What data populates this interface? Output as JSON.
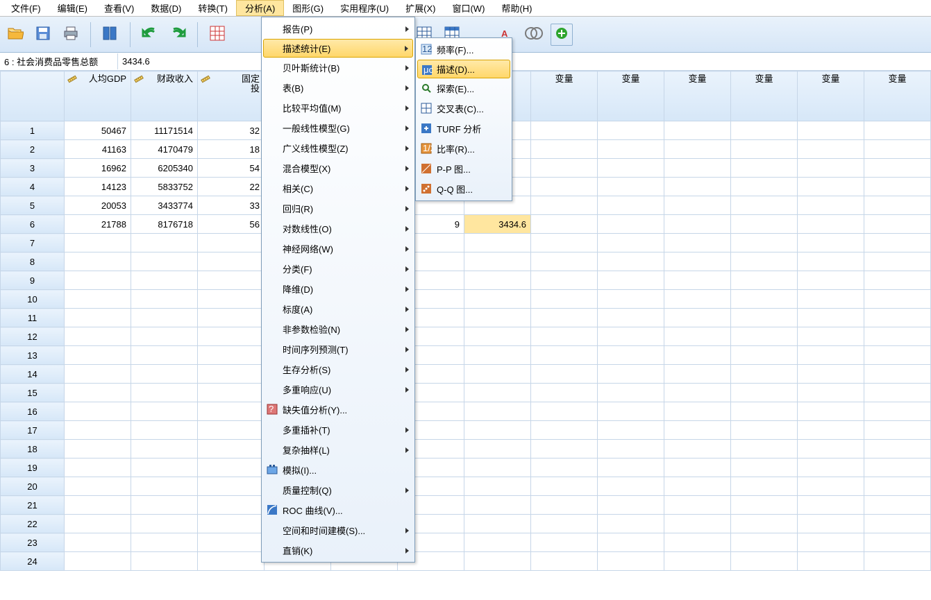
{
  "menubar": {
    "file": "文件(F)",
    "edit": "编辑(E)",
    "view": "查看(V)",
    "data": "数据(D)",
    "transform": "转换(T)",
    "analyze": "分析(A)",
    "graph": "图形(G)",
    "utilities": "实用程序(U)",
    "extensions": "扩展(X)",
    "window": "窗口(W)",
    "help": "帮助(H)"
  },
  "formula": {
    "ref": "6 : 社会消费品零售总额",
    "val": "3434.6"
  },
  "columns": {
    "c1": "人均GDP",
    "c2": "财政收入",
    "c3": "固定",
    "c3b": "投",
    "var": "变量"
  },
  "rows": [
    {
      "r": 1,
      "c1": "50467",
      "c2": "11171514",
      "c3": "32"
    },
    {
      "r": 2,
      "c1": "41163",
      "c2": "4170479",
      "c3": "18"
    },
    {
      "r": 3,
      "c1": "16962",
      "c2": "6205340",
      "c3": "54"
    },
    {
      "r": 4,
      "c1": "14123",
      "c2": "5833752",
      "c3": "22"
    },
    {
      "r": 5,
      "c1": "20053",
      "c2": "3433774",
      "c3": "33"
    },
    {
      "r": 6,
      "c1": "21788",
      "c2": "8176718",
      "c3": "56"
    }
  ],
  "row6_extra": {
    "colA": "9",
    "colB": "3434.6"
  },
  "analyze_menu": [
    {
      "label": "报告(P)",
      "sub": true
    },
    {
      "label": "描述统计(E)",
      "sub": true,
      "hl": true
    },
    {
      "label": "贝叶斯统计(B)",
      "sub": true
    },
    {
      "label": "表(B)",
      "sub": true
    },
    {
      "label": "比较平均值(M)",
      "sub": true
    },
    {
      "label": "一般线性模型(G)",
      "sub": true
    },
    {
      "label": "广义线性模型(Z)",
      "sub": true
    },
    {
      "label": "混合模型(X)",
      "sub": true
    },
    {
      "label": "相关(C)",
      "sub": true
    },
    {
      "label": "回归(R)",
      "sub": true
    },
    {
      "label": "对数线性(O)",
      "sub": true
    },
    {
      "label": "神经网络(W)",
      "sub": true
    },
    {
      "label": "分类(F)",
      "sub": true
    },
    {
      "label": "降维(D)",
      "sub": true
    },
    {
      "label": "标度(A)",
      "sub": true
    },
    {
      "label": "非参数检验(N)",
      "sub": true
    },
    {
      "label": "时间序列预测(T)",
      "sub": true
    },
    {
      "label": "生存分析(S)",
      "sub": true
    },
    {
      "label": "多重响应(U)",
      "sub": true
    },
    {
      "label": "缺失值分析(Y)...",
      "sub": false,
      "icon": "mv"
    },
    {
      "label": "多重插补(T)",
      "sub": true
    },
    {
      "label": "复杂抽样(L)",
      "sub": true
    },
    {
      "label": "模拟(I)...",
      "sub": false,
      "icon": "sim"
    },
    {
      "label": "质量控制(Q)",
      "sub": true
    },
    {
      "label": "ROC 曲线(V)...",
      "sub": false,
      "icon": "roc"
    },
    {
      "label": "空间和时间建模(S)...",
      "sub": true
    },
    {
      "label": "直销(K)",
      "sub": true
    }
  ],
  "desc_menu": [
    {
      "label": "频率(F)...",
      "icon": "freq"
    },
    {
      "label": "描述(D)...",
      "icon": "desc",
      "hl": true
    },
    {
      "label": "探索(E)...",
      "icon": "expl"
    },
    {
      "label": "交叉表(C)...",
      "icon": "cross"
    },
    {
      "label": "TURF 分析",
      "icon": "turf"
    },
    {
      "label": "比率(R)...",
      "icon": "ratio"
    },
    {
      "label": "P-P 图...",
      "icon": "pp"
    },
    {
      "label": "Q-Q 图...",
      "icon": "qq"
    }
  ],
  "icons": {
    "open": "open",
    "save": "save",
    "print": "print",
    "columns": "columns",
    "undo": "undo",
    "redo": "redo",
    "grid": "grid",
    "table1": "table1",
    "table2": "table2",
    "font": "font",
    "venn": "venn",
    "plus": "plus"
  },
  "totalRows": 24
}
